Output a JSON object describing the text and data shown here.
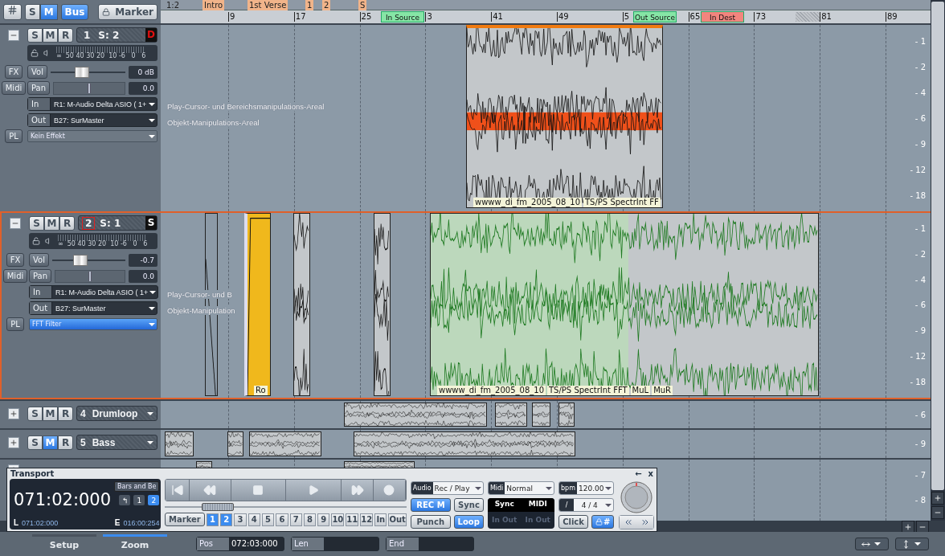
{
  "toolbar": {
    "buttons": [
      {
        "label": "S",
        "on": false
      },
      {
        "label": "M",
        "on": true
      },
      {
        "label": "Bus",
        "on": true
      }
    ],
    "marker_button": "Marker"
  },
  "ruler": {
    "markers": [
      {
        "label": "1:2",
        "kind": "start"
      },
      {
        "label": "Intro",
        "kind": "marker"
      },
      {
        "label": "1st Verse",
        "kind": "marker"
      },
      {
        "label": "1",
        "kind": "marker"
      },
      {
        "label": "2",
        "kind": "marker"
      },
      {
        "label": "S",
        "kind": "marker"
      }
    ],
    "bars": [
      "9",
      "17",
      "25",
      "3",
      "41",
      "49",
      "5",
      "65",
      "73",
      "81",
      "89"
    ],
    "ranges": [
      {
        "label": "In Source",
        "kind": "in"
      },
      {
        "label": "Out Source",
        "kind": "out"
      },
      {
        "label": "In Dest",
        "kind": "dest"
      }
    ]
  },
  "tracks": [
    {
      "number": "1",
      "name": "S: 2",
      "status": {
        "text": "D",
        "kind": "alert"
      },
      "expanded": true,
      "selected": false,
      "buttons": [
        {
          "label": "S",
          "on": false
        },
        {
          "label": "M",
          "on": false
        },
        {
          "label": "R",
          "on": false
        }
      ],
      "meter_scale": "∞  50 40 30 20  10 -6   0   6",
      "fx_button": "FX",
      "midi_button": "Midi",
      "pl_button": "PL",
      "vol_label": "Vol",
      "pan_label": "Pan",
      "volume": {
        "level": 0.42,
        "reading": "0 dB"
      },
      "pan": {
        "level": 0.5,
        "reading": "0.0"
      },
      "in_label": "In",
      "input": "R1: M-Audio Delta ASIO ( 1+",
      "out_label": "Out",
      "output": "B27: SurMaster",
      "plugin": {
        "label": "Kein Effekt",
        "active": false
      },
      "area_labels": [
        "Play-Cursor- und Bereichsmanipulations-Areal",
        "Objekt-Manipulations-Areal"
      ],
      "scale": [
        "- 1",
        "- 2",
        "- 4",
        "- 6",
        "- 9",
        "- 12",
        "- 18"
      ],
      "clips": [
        {
          "kind": "effect",
          "selected": false,
          "labels": [
            "wwww_di_fm_2005_08_10",
            "TS/PS SpectrInt FF"
          ]
        }
      ]
    },
    {
      "number": "2",
      "name": "S: 1",
      "status": {
        "text": "S",
        "kind": "normal"
      },
      "expanded": true,
      "selected": true,
      "buttons": [
        {
          "label": "S",
          "on": false
        },
        {
          "label": "M",
          "on": false
        },
        {
          "label": "R",
          "on": false
        }
      ],
      "meter_scale": "∞  50 40 30 20  10 -6   0   6",
      "fx_button": "FX",
      "midi_button": "Midi",
      "pl_button": "PL",
      "vol_label": "Vol",
      "pan_label": "Pan",
      "volume": {
        "level": 0.38,
        "reading": "-0.7"
      },
      "pan": {
        "level": 0.5,
        "reading": "0.0"
      },
      "in_label": "In",
      "input": "R1: M-Audio Delta ASIO ( 1+",
      "out_label": "Out",
      "output": "B27: SurMaster",
      "plugin": {
        "label": "FFT Filter",
        "active": true
      },
      "area_labels": [
        "Play-Cursor- und B",
        "Objekt-Manipulation"
      ],
      "scale": [
        "- 1",
        "- 2",
        "- 4",
        "- 6",
        "- 9",
        "- 12",
        "- 18"
      ],
      "clips": [
        {
          "kind": "envelope",
          "selected": false
        },
        {
          "kind": "fade",
          "selected": false,
          "labels": [
            "Ro"
          ]
        },
        {
          "kind": "wave",
          "selected": false
        },
        {
          "kind": "wave",
          "selected": false
        },
        {
          "kind": "wave",
          "selected": true,
          "labels": [
            "wwww_di_fm_2005_08_10",
            "TS/PS SpectrInt FFT",
            "MuL",
            "MuR"
          ]
        }
      ]
    },
    {
      "number": "4",
      "name": "Drumloop",
      "expanded": false,
      "selected": false,
      "buttons": [
        {
          "label": "S",
          "on": false
        },
        {
          "label": "M",
          "on": false
        },
        {
          "label": "R",
          "on": false
        }
      ],
      "scale": [
        "- 6"
      ],
      "clips": [
        {
          "kind": "wave",
          "selected": false
        },
        {
          "kind": "wave",
          "selected": false
        },
        {
          "kind": "wave",
          "selected": false
        },
        {
          "kind": "wave",
          "selected": false
        }
      ]
    },
    {
      "number": "5",
      "name": "Bass",
      "expanded": false,
      "selected": false,
      "buttons": [
        {
          "label": "S",
          "on": false
        },
        {
          "label": "M",
          "on": true
        },
        {
          "label": "R",
          "on": false
        }
      ],
      "scale": [
        "- 9"
      ],
      "clips": [
        {
          "kind": "wave",
          "selected": false
        },
        {
          "kind": "wave",
          "selected": false
        },
        {
          "kind": "wave",
          "selected": false
        },
        {
          "kind": "wave",
          "selected": false
        }
      ]
    },
    {
      "expanded": false,
      "selected": false,
      "scale": [
        "- 7",
        "- 8"
      ],
      "clips": [
        {
          "kind": "wave",
          "selected": false
        },
        {
          "kind": "wave",
          "selected": false
        }
      ]
    }
  ],
  "transport": {
    "title": "Transport",
    "window_buttons": [
      "←",
      "x"
    ],
    "display": {
      "time": "071:02:000",
      "format": "Bars and Be",
      "modes": [
        {
          "label": "↰",
          "selected": false
        },
        {
          "label": "1",
          "selected": false
        },
        {
          "label": "2",
          "selected": true
        }
      ],
      "l_label": "L",
      "l_value": "071:02:000",
      "e_label": "E",
      "e_value": "016:00:254"
    },
    "controls": [
      {
        "kind": "to-start"
      },
      {
        "kind": "rewind"
      },
      {
        "kind": "stop"
      },
      {
        "kind": "play"
      },
      {
        "kind": "forward"
      },
      {
        "kind": "record"
      }
    ],
    "position": {
      "level": 0.22
    },
    "marker_button": "Marker",
    "marker_slots": [
      {
        "label": "1",
        "selected": true
      },
      {
        "label": "2",
        "selected": true
      },
      {
        "label": "3",
        "selected": false
      },
      {
        "label": "4",
        "selected": false
      },
      {
        "label": "5",
        "selected": false
      },
      {
        "label": "6",
        "selected": false
      },
      {
        "label": "7",
        "selected": false
      },
      {
        "label": "8",
        "selected": false
      },
      {
        "label": "9",
        "selected": false
      },
      {
        "label": "10",
        "selected": false
      },
      {
        "label": "11",
        "selected": false
      },
      {
        "label": "12",
        "selected": false
      },
      {
        "label": "In",
        "selected": false
      },
      {
        "label": "Out",
        "selected": false
      }
    ],
    "audio": {
      "tag": "Audio",
      "value": "Rec / Play"
    },
    "rec_m": {
      "label": "REC M",
      "on": true
    },
    "sync": {
      "label": "Sync",
      "on": false
    },
    "punch": {
      "label": "Punch",
      "on": false
    },
    "loop": {
      "label": "Loop",
      "on": true
    },
    "midi": {
      "tag": "Midi",
      "value": "Normal"
    },
    "sync_panel": {
      "headers": [
        "Sync",
        "MIDI"
      ],
      "rows": [
        "In Out",
        "In Out"
      ]
    },
    "bpm": {
      "tag": "bpm",
      "value": "120.00"
    },
    "time_signature": {
      "tag": "/",
      "value": "4 / 4"
    },
    "click": {
      "label": "Click",
      "on": false
    },
    "lock": {
      "label": "#",
      "on": true
    }
  },
  "bottom_bar": {
    "tabs": [
      {
        "label": "Setup",
        "selected": false
      },
      {
        "label": "Zoom",
        "selected": true
      }
    ],
    "fields": [
      {
        "label": "Pos",
        "value": "072:03:000"
      },
      {
        "label": "Len"
      },
      {
        "label": "End"
      }
    ]
  }
}
